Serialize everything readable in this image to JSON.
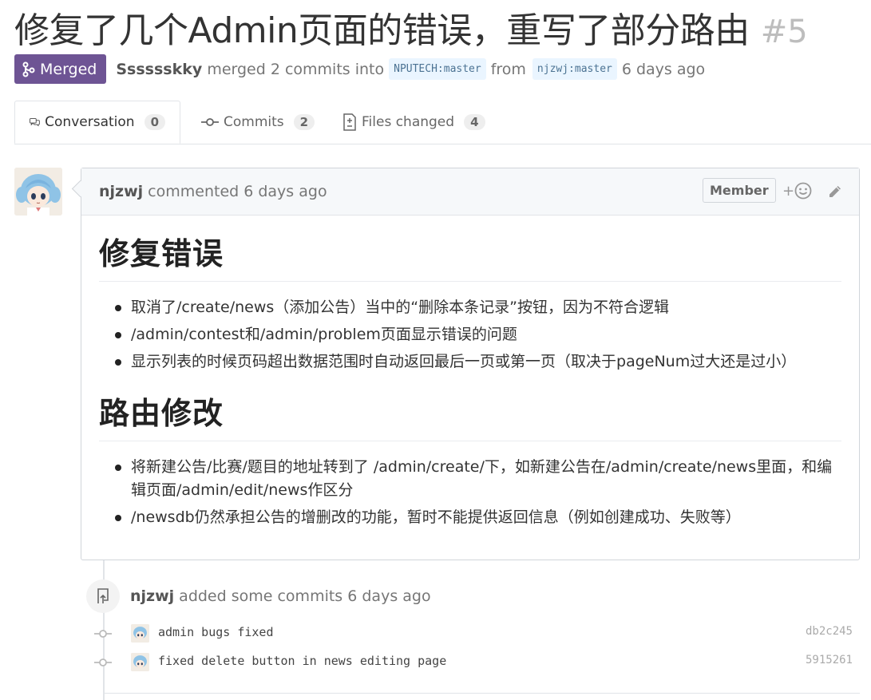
{
  "pr": {
    "title": "修复了几个Admin页面的错误，重写了部分路由",
    "number": "#5",
    "state": "Merged",
    "author": "Sssssskky",
    "merge_text": "merged 2 commits into",
    "base_branch": "NPUTECH:master",
    "from_text": "from",
    "head_branch": "njzwj:master",
    "time": "6 days ago"
  },
  "tabs": [
    {
      "label": "Conversation",
      "count": "0",
      "icon": "comment-discussion-icon"
    },
    {
      "label": "Commits",
      "count": "2",
      "icon": "commit-icon"
    },
    {
      "label": "Files changed",
      "count": "4",
      "icon": "file-diff-icon"
    }
  ],
  "comment": {
    "author": "njzwj",
    "action": "commented 6 days ago",
    "role_badge": "Member",
    "react_label": "+",
    "sections": [
      {
        "heading": "修复错误",
        "items": [
          "取消了/create/news（添加公告）当中的“删除本条记录”按钮，因为不符合逻辑",
          "/admin/contest和/admin/problem页面显示错误的问题",
          "显示列表的时候页码超出数据范围时自动返回最后一页或第一页（取决于pageNum过大还是过小）"
        ]
      },
      {
        "heading": "路由修改",
        "items": [
          "将新建公告/比赛/题目的地址转到了 /admin/create/下，如新建公告在/admin/create/news里面，和编辑页面/admin/edit/news作区分",
          "/newsdb仍然承担公告的增删改的功能，暂时不能提供返回信息（例如创建成功、失败等）"
        ]
      }
    ]
  },
  "timeline": {
    "author": "njzwj",
    "event": "added some commits 6 days ago",
    "commits": [
      {
        "message": "admin bugs fixed",
        "sha": "db2c245"
      },
      {
        "message": "fixed delete button in news editing page",
        "sha": "5915261"
      }
    ]
  },
  "colors": {
    "merged": "#6e5494",
    "branch_bg": "#eaf5ff",
    "branch_text": "#4c7393"
  }
}
